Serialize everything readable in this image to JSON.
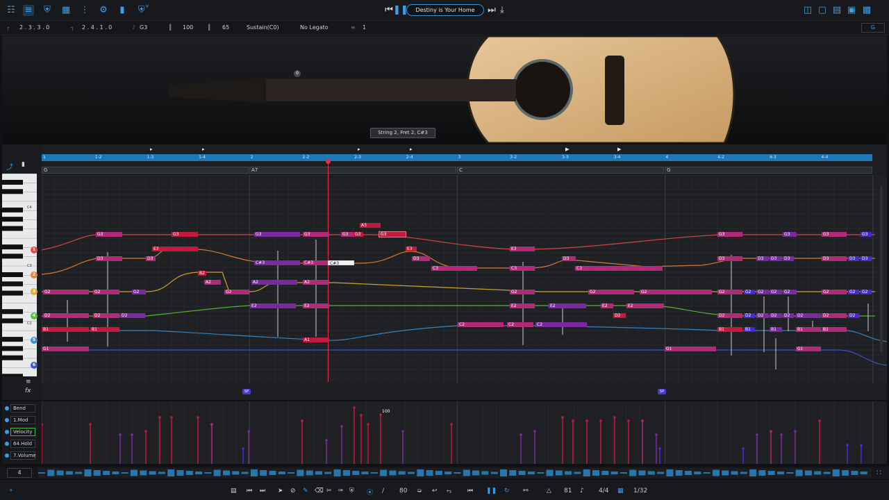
{
  "topbar": {
    "song_title": "Destiny is Your Home",
    "left_icons": [
      "mixer-icon",
      "settings-sliders-icon",
      "shield-icon",
      "grid-icon",
      "eq-icon",
      "gear-icon",
      "bars-icon",
      "shield-dropdown-icon"
    ],
    "right_icons": [
      "layout-1-icon",
      "layout-2-icon",
      "layout-3-icon",
      "layout-4-icon",
      "layout-5-icon"
    ]
  },
  "infobar": {
    "start_pos": "2 . 3 . 3 . 0",
    "end_pos": "2 . 4 . 1 . 0",
    "note": "G3",
    "velocity": "100",
    "length": "65",
    "articulation": "Sustain(C0)",
    "legato": "No Legato",
    "channel": "1",
    "key_button": "G"
  },
  "guitar": {
    "tooltip": "String 2, Fret 2, C#3",
    "capo_marker": "0"
  },
  "roll": {
    "bars": [
      "1",
      "1-2",
      "1-3",
      "1-4",
      "2",
      "2-2",
      "2-3",
      "2-4",
      "3",
      "3-2",
      "3-3",
      "3-4",
      "4",
      "4-2",
      "4-3",
      "4-4"
    ],
    "chords": [
      "G",
      "A7",
      "C",
      "G"
    ],
    "octave_labels": [
      "C4",
      "C3",
      "C2"
    ],
    "strings": [
      "1",
      "2",
      "3",
      "4",
      "5",
      "6"
    ],
    "sp_marks": [
      "SP",
      "SP"
    ]
  },
  "ctrl": {
    "lanes": [
      "Bend",
      "1.Mod",
      "Velocity",
      "64.Hold",
      "7.Volume"
    ],
    "value_label": "100"
  },
  "mini": {
    "zoom": "4"
  },
  "bottombar": {
    "velocity": "80",
    "tempo": "81",
    "time_sig": "4/4",
    "quantize": "1/32"
  },
  "colors": {
    "accent": "#3aa0e8",
    "note_red": "#c4193e",
    "note_magenta": "#b02a78",
    "note_purple": "#7a2aa0",
    "note_blue": "#4a2ad0",
    "string_1": "#e84a4a",
    "string_2": "#e8823a",
    "string_3": "#e0b02a",
    "string_4": "#5cc03a",
    "string_5": "#3a8fd6",
    "string_6": "#3a58d6"
  }
}
